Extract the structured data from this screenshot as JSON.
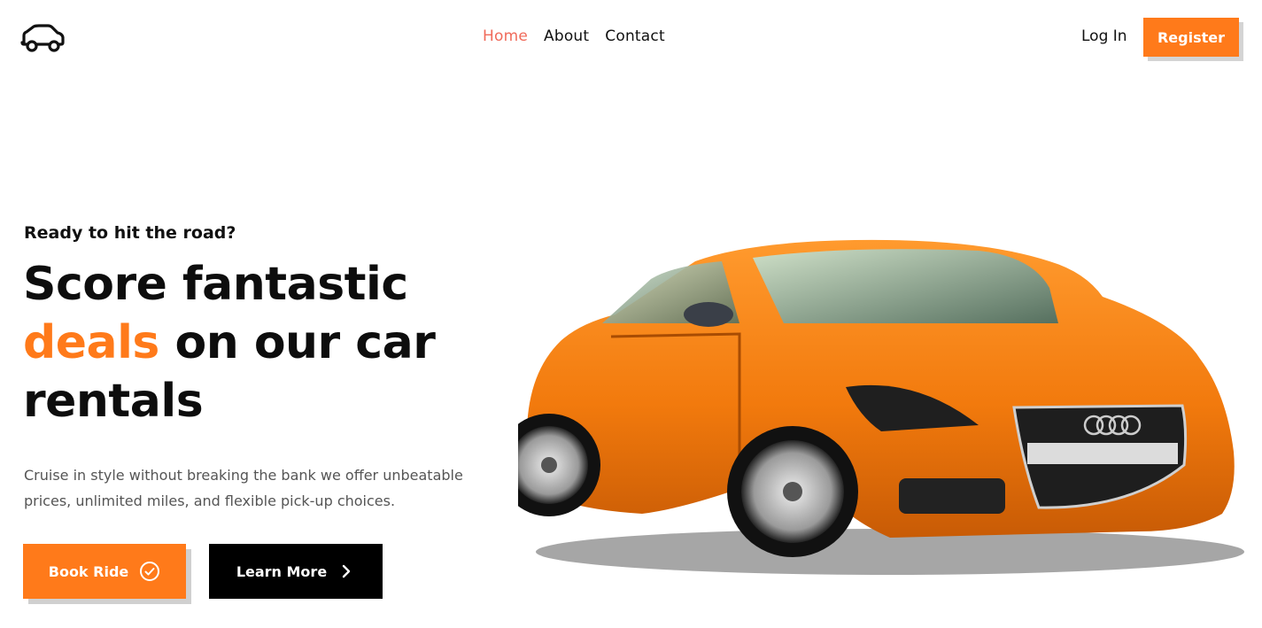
{
  "header": {
    "logo_icon": "car-icon",
    "nav": [
      {
        "label": "Home",
        "active": true
      },
      {
        "label": "About",
        "active": false
      },
      {
        "label": "Contact",
        "active": false
      }
    ],
    "login_label": "Log In",
    "register_label": "Register"
  },
  "hero": {
    "eyebrow": "Ready to hit the road?",
    "headline_part1": "Score fantastic",
    "headline_accent": "deals",
    "headline_part2": "on our car rentals",
    "description": "Cruise in style without breaking the bank we offer unbeatable prices, unlimited miles, and flexible pick-up choices.",
    "book_button_label": "Book Ride",
    "book_button_icon": "check-circle-icon",
    "learn_button_label": "Learn More",
    "learn_button_icon": "chevron-right-icon"
  },
  "colors": {
    "accent": "#ff7a1a",
    "nav_active": "#f06a5a",
    "dark": "#000000"
  }
}
